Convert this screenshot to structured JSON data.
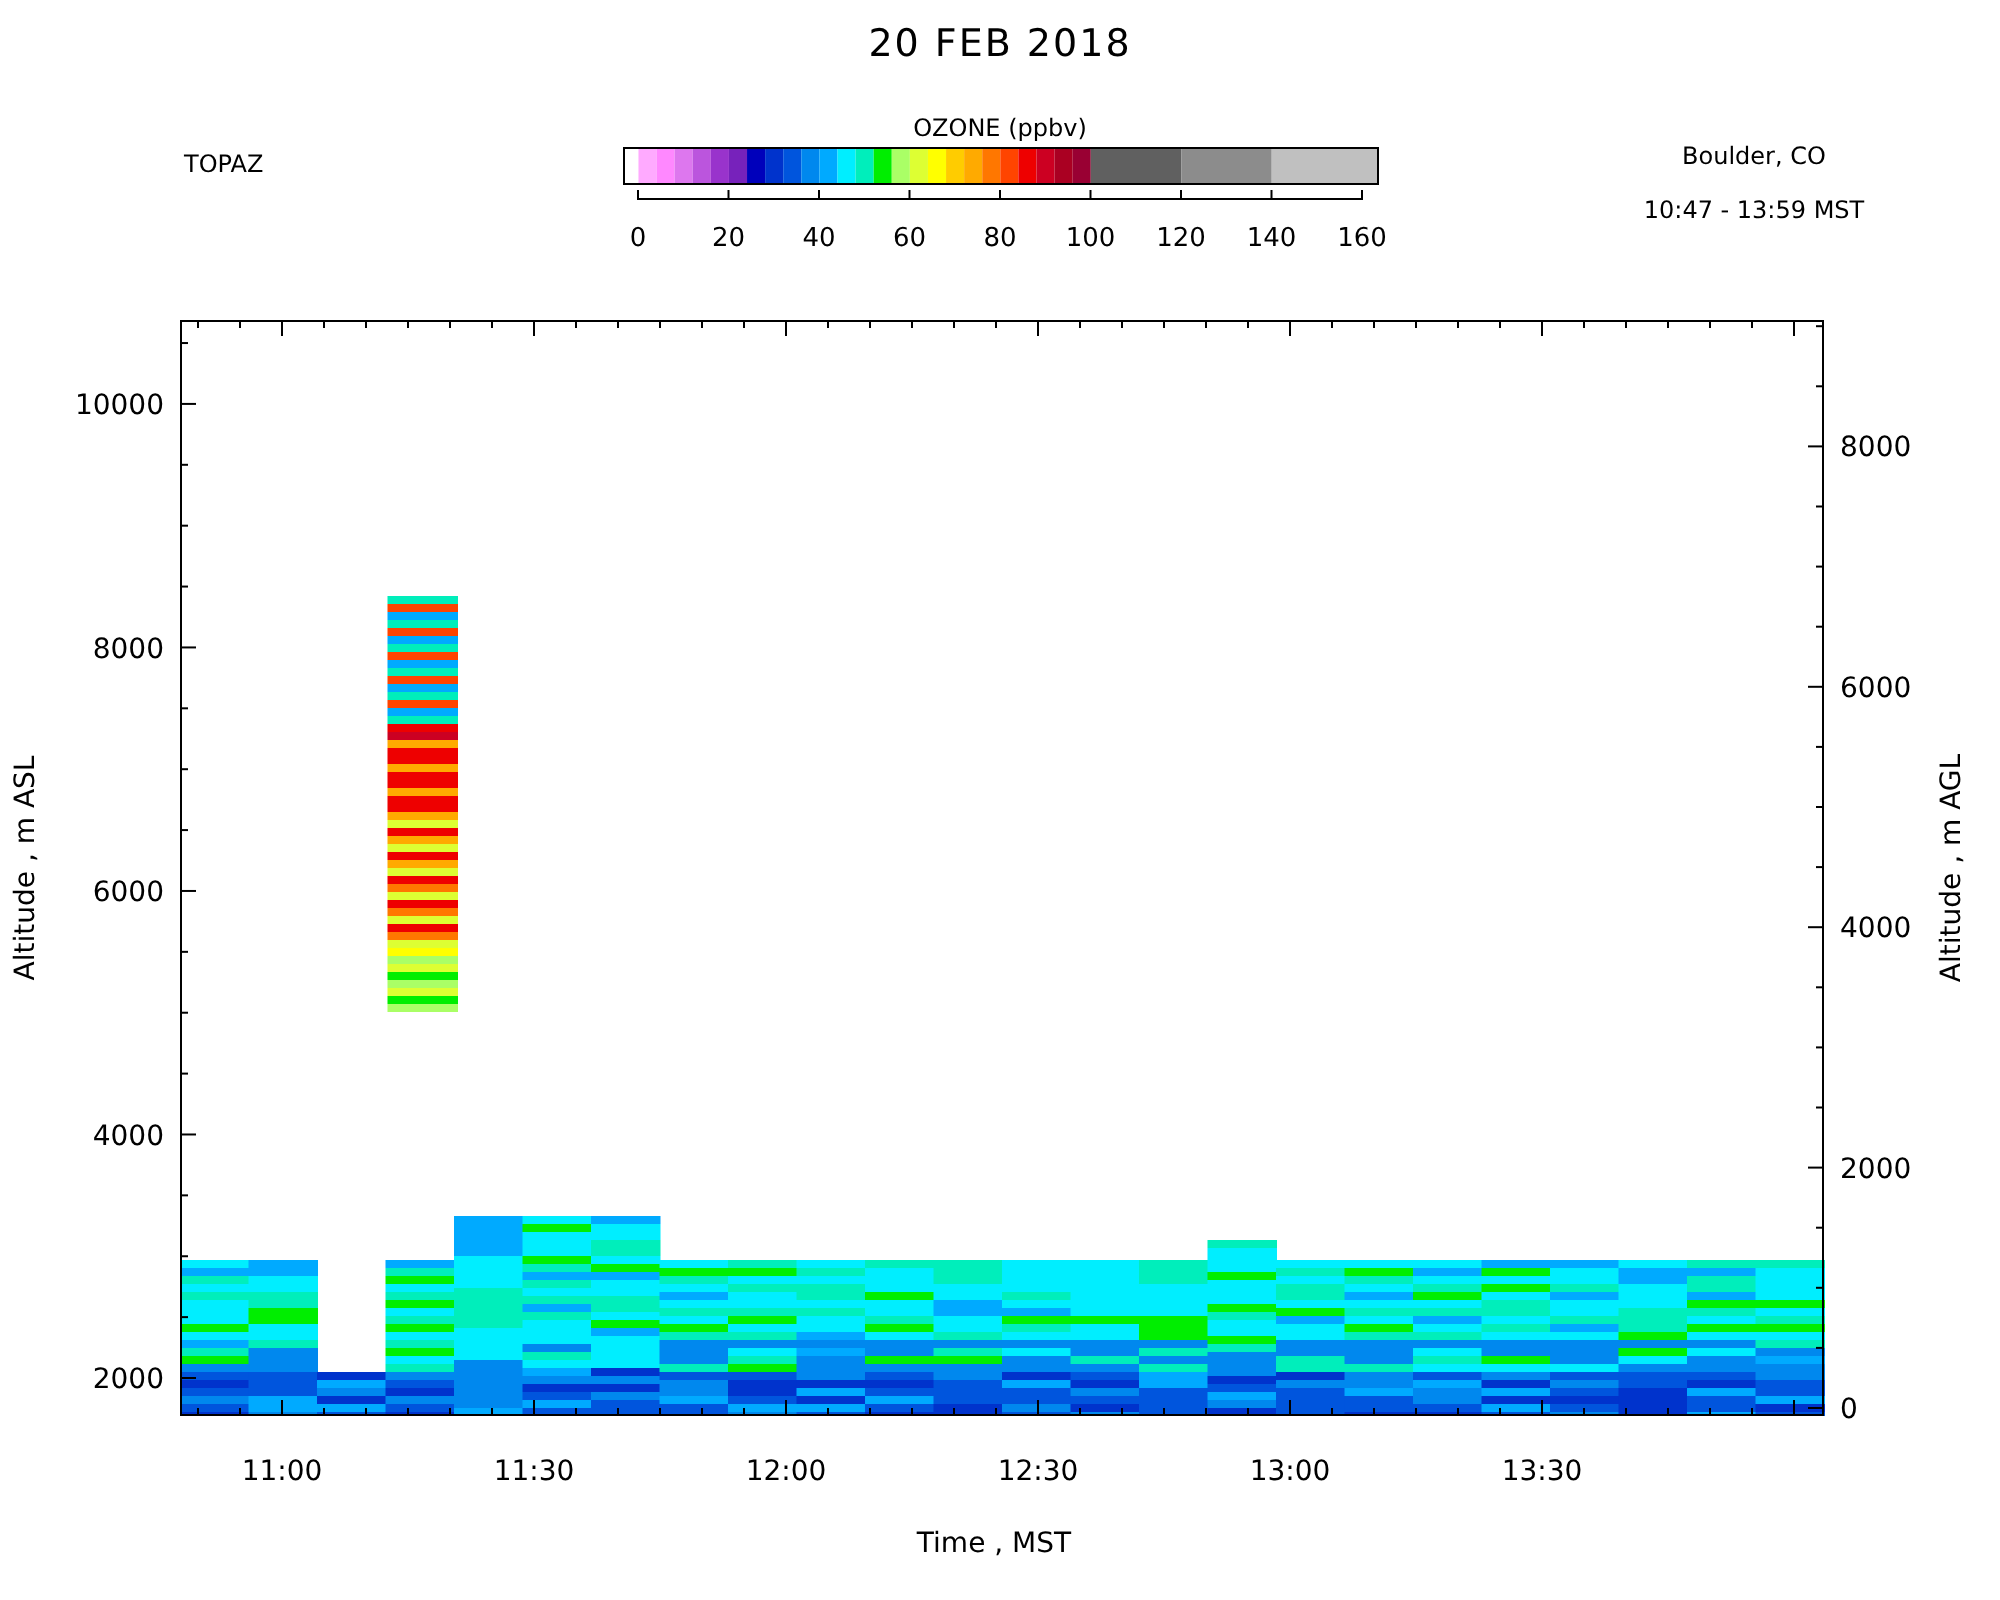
{
  "title": "20 FEB 2018",
  "station": "TOPAZ",
  "location": "Boulder, CO",
  "time_range": "10:47 - 13:59 MST",
  "colorbar": {
    "title": "OZONE (ppbv)",
    "segments": [
      {
        "kind": "step",
        "color": "#ffaaff"
      },
      {
        "kind": "step",
        "color": "#ff88ff"
      },
      {
        "kind": "step",
        "color": "#dd77ee"
      },
      {
        "kind": "step",
        "color": "#bb55dd"
      },
      {
        "kind": "step",
        "color": "#9933cc"
      },
      {
        "kind": "step",
        "color": "#7722bb"
      },
      {
        "kind": "step",
        "color": "#0000bb"
      },
      {
        "kind": "step",
        "color": "#0033cc"
      },
      {
        "kind": "step",
        "color": "#0055dd"
      },
      {
        "kind": "step",
        "color": "#0088ee"
      },
      {
        "kind": "step",
        "color": "#00aaff"
      },
      {
        "kind": "step",
        "color": "#00eeff"
      },
      {
        "kind": "step",
        "color": "#00eebb"
      },
      {
        "kind": "step",
        "color": "#00ee00"
      },
      {
        "kind": "step",
        "color": "#aaff66"
      },
      {
        "kind": "step",
        "color": "#ddff33"
      },
      {
        "kind": "step",
        "color": "#ffff00"
      },
      {
        "kind": "step",
        "color": "#ffcc00"
      },
      {
        "kind": "step",
        "color": "#ffaa00"
      },
      {
        "kind": "step",
        "color": "#ff7700"
      },
      {
        "kind": "step",
        "color": "#ff4400"
      },
      {
        "kind": "step",
        "color": "#ee0000"
      },
      {
        "kind": "step",
        "color": "#cc0022"
      },
      {
        "kind": "step",
        "color": "#aa0022"
      },
      {
        "kind": "step",
        "color": "#990033"
      },
      {
        "kind": "wide",
        "color": "#606060"
      },
      {
        "kind": "wide",
        "color": "#8c8c8c"
      },
      {
        "kind": "end",
        "color": "#c0c0c0"
      }
    ],
    "ticks": [
      "0",
      "20",
      "40",
      "60",
      "80",
      "100",
      "120",
      "140",
      "160"
    ]
  },
  "plot": {
    "y_left": {
      "label": "Altitude , m ASL",
      "ticks": [
        "10000",
        "8000",
        "6000",
        "4000",
        "2000"
      ]
    },
    "y_right": {
      "label": "Altitude , m AGL",
      "ticks": [
        "8000",
        "6000",
        "4000",
        "2000",
        "0"
      ]
    },
    "x": {
      "label": "Time , MST",
      "ticks": [
        "11:00",
        "11:30",
        "12:00",
        "12:30",
        "13:00",
        "13:30"
      ]
    }
  }
}
